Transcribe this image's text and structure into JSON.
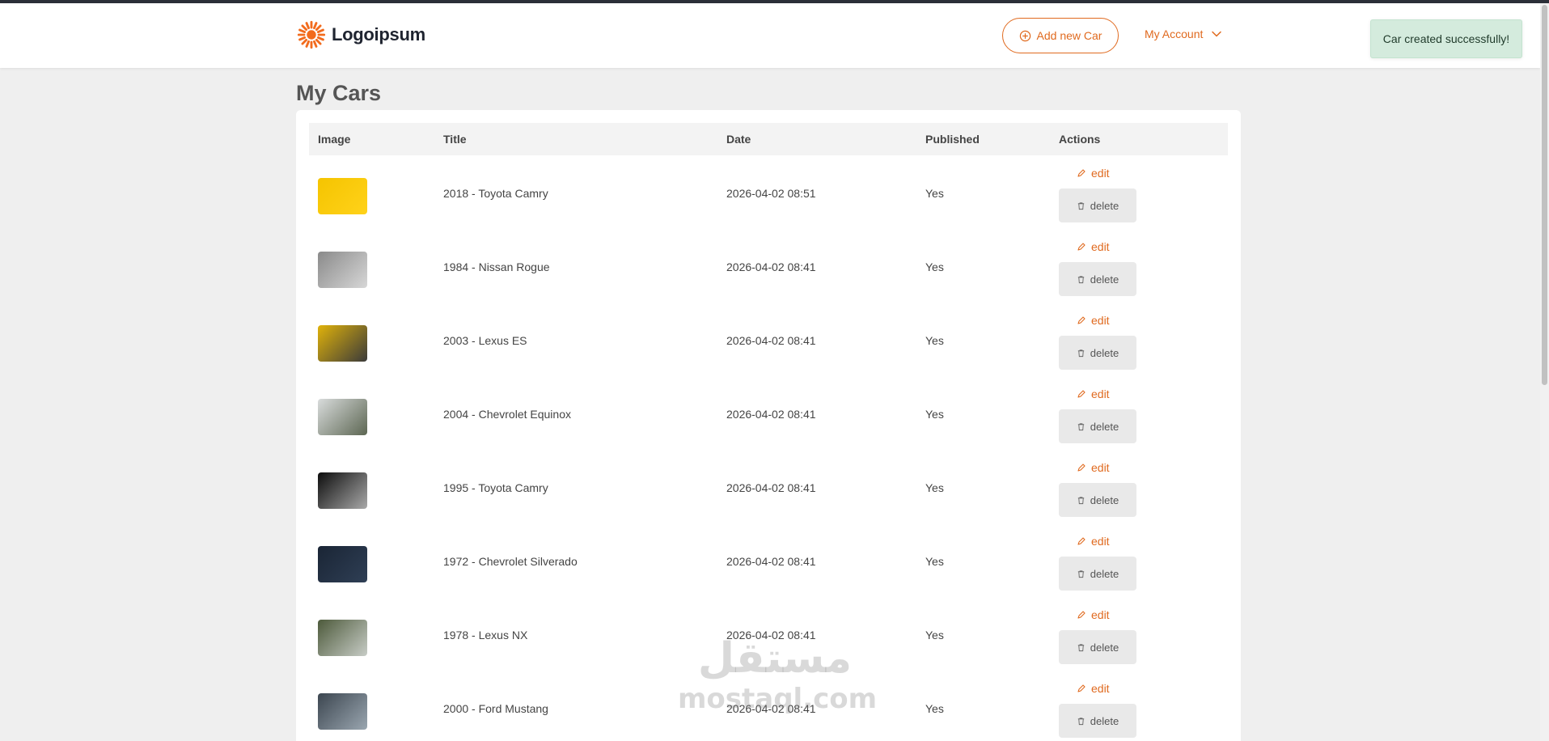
{
  "header": {
    "logo_text": "Logoipsum",
    "add_button_label": "Add new Car",
    "account_label": "My Account"
  },
  "toast": {
    "message": "Car created successfully!"
  },
  "page": {
    "title": "My Cars"
  },
  "table": {
    "columns": [
      "Image",
      "Title",
      "Date",
      "Published",
      "Actions"
    ],
    "edit_label": "edit",
    "delete_label": "delete",
    "rows": [
      {
        "title": "2018 - Toyota Camry",
        "date": "2026-04-02 08:51",
        "published": "Yes",
        "thumb_colors": [
          "#f5c400",
          "#ffd21a"
        ]
      },
      {
        "title": "1984 - Nissan Rogue",
        "date": "2026-04-02 08:41",
        "published": "Yes",
        "thumb_colors": [
          "#8a8a8a",
          "#d7d7d7"
        ]
      },
      {
        "title": "2003 - Lexus ES",
        "date": "2026-04-02 08:41",
        "published": "Yes",
        "thumb_colors": [
          "#e0b20a",
          "#3a3a3a"
        ]
      },
      {
        "title": "2004 - Chevrolet Equinox",
        "date": "2026-04-02 08:41",
        "published": "Yes",
        "thumb_colors": [
          "#d9dcdc",
          "#5c6652"
        ]
      },
      {
        "title": "1995 - Toyota Camry",
        "date": "2026-04-02 08:41",
        "published": "Yes",
        "thumb_colors": [
          "#0d0d0d",
          "#a9a9a9"
        ]
      },
      {
        "title": "1972 - Chevrolet Silverado",
        "date": "2026-04-02 08:41",
        "published": "Yes",
        "thumb_colors": [
          "#1a2535",
          "#2f3f55"
        ]
      },
      {
        "title": "1978 - Lexus NX",
        "date": "2026-04-02 08:41",
        "published": "Yes",
        "thumb_colors": [
          "#4d5a3b",
          "#c7ccc6"
        ]
      },
      {
        "title": "2000 - Ford Mustang",
        "date": "2026-04-02 08:41",
        "published": "Yes",
        "thumb_colors": [
          "#3c4650",
          "#9aa6b0"
        ]
      }
    ]
  },
  "watermark": {
    "arabic": "مستقل",
    "latin": "mostaql.com"
  },
  "colors": {
    "accent": "#e06a1f",
    "toast_bg": "#d4ebdd"
  }
}
